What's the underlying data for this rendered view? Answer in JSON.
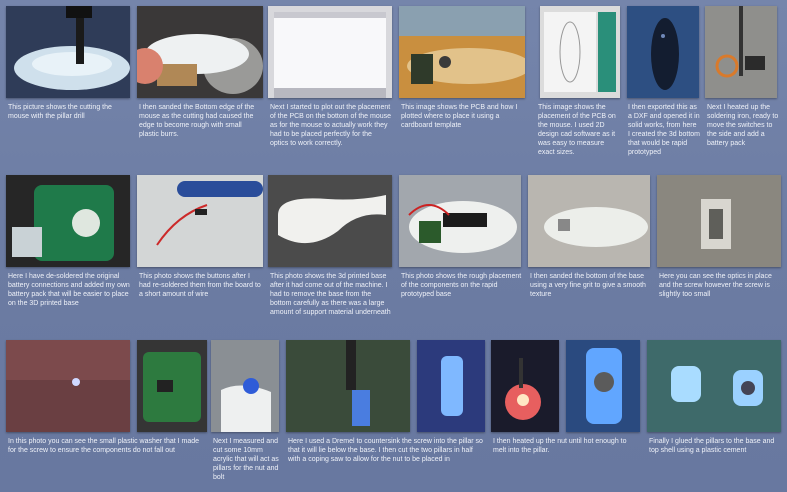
{
  "captions": [
    "This picture shows the cutting the mouse with the pillar drill",
    "I then sanded the Bottom edge of the mouse as the cutting had caused the edge to become rough with small plastic burrs.",
    "Next I started to plot out the placement of the PCB on the bottom of the mouse as for the mouse to actually work they had to be placed perfectly for the optics to work correctly.",
    "This image shows the PCB and how I plotted where to place it using a cardboard template",
    "This image shows the placement of the PCB on the mouse. I used 2D design cad software as it was easy to measure exact sizes.",
    "I then exported this as a DXF and opened it in solid works, from here I created the 3d bottom that would be rapid prototyped",
    "Next I heated up the soldering iron, ready to move the switches to the side and add a battery pack",
    "Here I have de-soldered the original battery connections and added my own battery pack that will be easier to place on the 3D printed base",
    "This photo shows the buttons after I had re-soldered them from the board to a short amount of wire",
    "This photo shows the 3d printed base after it had come out of the machine. I had to remove the base from the bottom carefully as there was a large amount of support material underneath",
    "This photo shows the rough placement of the components on the rapid prototyped base",
    "I then sanded the bottom of the base using a very fine grit to give a smooth texture",
    "Here you can see the optics in place and the screw however the screw is slightly too small",
    "In this photo you can see the small plastic washer that I made for the screw to ensure the components do not fall out",
    "Next I measured and cut some 10mm acrylic that will act as pillars for the nut and bolt",
    "Here I used a Dremel to countersink the screw into the pillar so that it will lie below the base. I then cut the two pillars in half with a coping saw to allow for the nut to be placed in",
    "I then heated up the nut until hot enough to melt into the pillar.",
    "Finally I glued the pillars to the base and top shell using a plastic cement"
  ]
}
